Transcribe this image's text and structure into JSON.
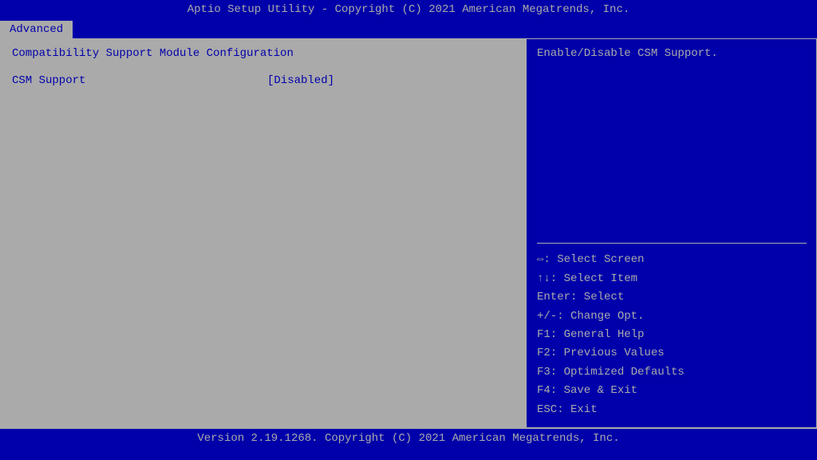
{
  "title_bar": {
    "text": "Aptio Setup Utility - Copyright (C) 2021 American Megatrends, Inc."
  },
  "tabs": [
    {
      "label": "Advanced",
      "active": true
    }
  ],
  "left_panel": {
    "section_title": "Compatibility Support Module Configuration",
    "settings": [
      {
        "name": "CSM Support",
        "value": "[Disabled]"
      }
    ]
  },
  "right_panel": {
    "help_text": "Enable/Disable CSM Support.",
    "key_bindings": [
      {
        "key": "⇔: Select Screen"
      },
      {
        "key": "↑↓: Select Item"
      },
      {
        "key": "Enter: Select"
      },
      {
        "key": "+/-: Change Opt."
      },
      {
        "key": "F1: General Help"
      },
      {
        "key": "F2: Previous Values"
      },
      {
        "key": "F3: Optimized Defaults"
      },
      {
        "key": "F4: Save & Exit"
      },
      {
        "key": "ESC: Exit"
      }
    ]
  },
  "footer": {
    "text": "Version 2.19.1268. Copyright (C) 2021 American Megatrends, Inc."
  }
}
